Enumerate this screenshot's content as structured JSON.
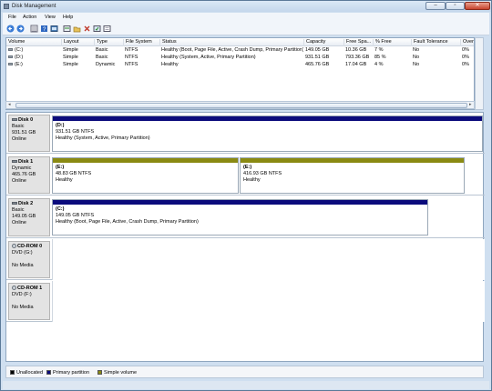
{
  "window": {
    "title": "Disk Management"
  },
  "menu": [
    "File",
    "Action",
    "View",
    "Help"
  ],
  "toolbar": {
    "buttons": [
      "back-icon",
      "forward-icon",
      "list-icon",
      "help-icon",
      "console-icon",
      "properties-icon",
      "folder-icon",
      "delete-icon",
      "refresh-icon",
      "export-icon"
    ]
  },
  "volume_table": {
    "columns": [
      "Volume",
      "Layout",
      "Type",
      "File System",
      "Status",
      "Capacity",
      "Free Spa...",
      "% Free",
      "Fault Tolerance",
      "Overhead"
    ],
    "rows": [
      [
        "(C:)",
        "Simple",
        "Basic",
        "NTFS",
        "Healthy (Boot, Page File, Active, Crash Dump, Primary Partition)",
        "149.05 GB",
        "10.36 GB",
        "7 %",
        "No",
        "0%"
      ],
      [
        "(D:)",
        "Simple",
        "Basic",
        "NTFS",
        "Healthy (System, Active, Primary Partition)",
        "931.51 GB",
        "793.36 GB",
        "85 %",
        "No",
        "0%"
      ],
      [
        "(E:)",
        "Simple",
        "Dynamic",
        "NTFS",
        "Healthy",
        "465.76 GB",
        "17.04 GB",
        "4 %",
        "No",
        "0%"
      ]
    ]
  },
  "disks": [
    {
      "name": "Disk 0",
      "type": "Basic",
      "size": "931.51 GB",
      "state": "Online",
      "partitions": [
        {
          "letter": "(D:)",
          "size": "931.51 GB NTFS",
          "status": "Healthy (System, Active, Primary Partition)",
          "kind": "primary"
        }
      ]
    },
    {
      "name": "Disk 1",
      "type": "Dynamic",
      "size": "465.76 GB",
      "state": "Online",
      "partitions": [
        {
          "letter": "(E:)",
          "size": "48.83 GB NTFS",
          "status": "Healthy",
          "kind": "simple"
        },
        {
          "letter": "(E:)",
          "size": "416.93 GB NTFS",
          "status": "Healthy",
          "kind": "simple"
        }
      ]
    },
    {
      "name": "Disk 2",
      "type": "Basic",
      "size": "149.05 GB",
      "state": "Online",
      "partitions": [
        {
          "letter": "(C:)",
          "size": "149.05 GB NTFS",
          "status": "Healthy (Boot, Page File, Active, Crash Dump, Primary Partition)",
          "kind": "primary"
        }
      ]
    }
  ],
  "cdroms": [
    {
      "name": "CD-ROM 0",
      "drive": "DVD (G:)",
      "media": "No Media"
    },
    {
      "name": "CD-ROM 1",
      "drive": "DVD (F:)",
      "media": "No Media"
    }
  ],
  "legend": [
    {
      "label": "Unallocated",
      "color": "#000000"
    },
    {
      "label": "Primary partition",
      "color": "#0b0b7c"
    },
    {
      "label": "Simple volume",
      "color": "#8a8a12"
    }
  ]
}
